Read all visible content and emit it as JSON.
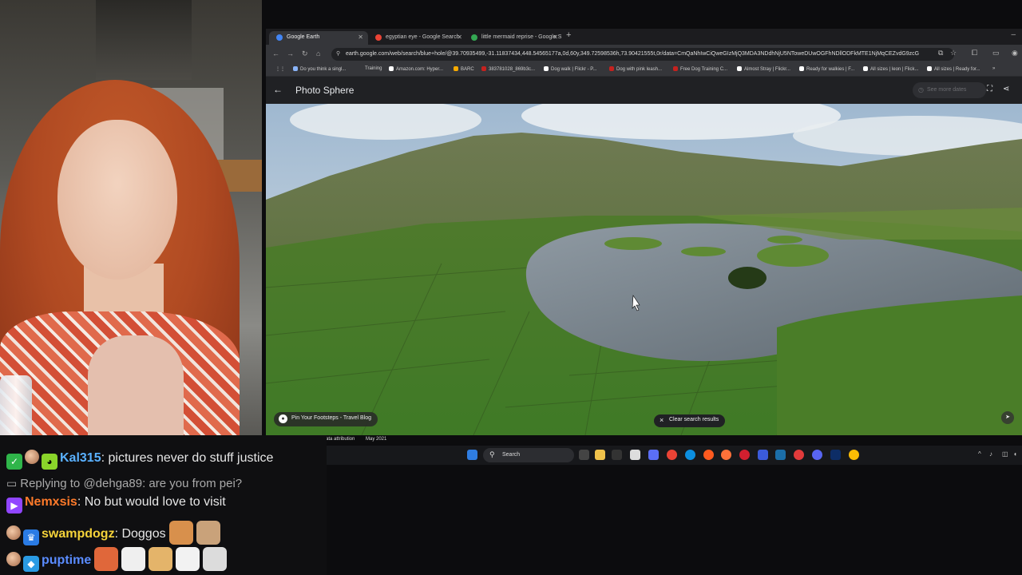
{
  "browser": {
    "tabs": [
      {
        "label": "Google Earth",
        "favicon_color": "#4285f4"
      },
      {
        "label": "egyptian eye - Google Search",
        "favicon_color": "#ea4335"
      },
      {
        "label": "little mermaid reprise - Google S",
        "favicon_color": "#34a853"
      }
    ],
    "url": "earth.google.com/web/search/blue+hole/@39.70935499,-31.11837434,448.54565177a,0d,60y,349.72598536h,73.90421555t,0r/data=CmQaNhIwCiQweGIzMjQ3MDA3NDdhNjU5NToweDUwOGFhNDllODFkMTE1NjMqCEZvdG9zcG",
    "bookmarks": [
      "Do you think a singl...",
      "Training",
      "Amazon.com: Hyper...",
      "BARC",
      "383781028_869b3c...",
      "Dog walk | Flickr - P...",
      "Dog with pink leash...",
      "Free Dog Training C...",
      "Almost Stray | Flickr...",
      "Ready for walkies | F...",
      "All sizes | leon | Flick...",
      "All sizes | Ready for..."
    ]
  },
  "earth": {
    "title": "Photo Sphere",
    "see_more_dates": "See more dates",
    "attribution_chip": "Pin Your Footsteps - Travel Blog",
    "clear_search": "Clear search results",
    "data_attribution": "ata attribution",
    "date": "May 2021"
  },
  "taskbar": {
    "search_placeholder": "Search"
  },
  "chat": {
    "messages": [
      {
        "user": "Kal315",
        "user_color": "#5ab1ff",
        "text": ": pictures never do stuff justice"
      },
      {
        "reply_to": "Replying to @dehga89: are you from pei?"
      },
      {
        "user": "Nemxsis",
        "user_color": "#ff7a2a",
        "text": ": No but would love to visit"
      },
      {
        "user": "swampdogz",
        "user_color": "#f5d33a",
        "text": ": Doggos"
      },
      {
        "user": "puptime",
        "user_color": "#5a8cff",
        "text": ""
      }
    ]
  },
  "colors": {
    "browser_bg": "#202124",
    "chat_bg": "#0f0f11",
    "accent_blue": "#8ab4f8"
  }
}
